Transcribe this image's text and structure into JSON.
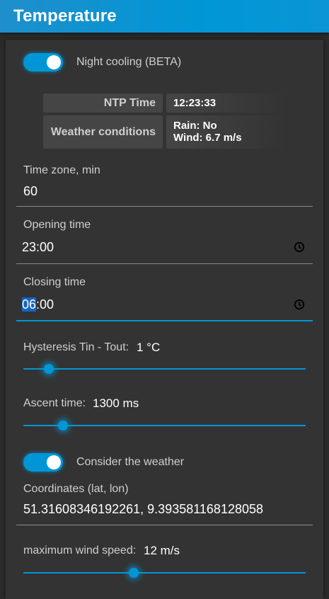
{
  "header": {
    "title": "Temperature"
  },
  "night_cooling": {
    "label": "Night cooling (BETA)",
    "enabled": true
  },
  "info": {
    "ntp_label": "NTP Time",
    "ntp_value": "12:23:33",
    "weather_label": "Weather conditions",
    "weather_rain": "Rain: No",
    "weather_wind": "Wind: 6.7 m/s"
  },
  "timezone": {
    "label": "Time zone, min",
    "value": "60"
  },
  "opening": {
    "label": "Opening time",
    "value": "23:00"
  },
  "closing": {
    "label": "Closing time",
    "hours": "06",
    "rest": ":00"
  },
  "hysteresis": {
    "label": "Hysteresis Tin - Tout:",
    "value": "1 °C",
    "level": 0.09
  },
  "ascent": {
    "label": "Ascent time:",
    "value": "1300 ms",
    "level": 0.14
  },
  "consider_weather": {
    "label": "Consider the weather",
    "enabled": true
  },
  "coordinates": {
    "label": "Coordinates (lat, lon)",
    "value": "51.31608346192261, 9.393581168128058"
  },
  "wind": {
    "label": "maximum wind speed:",
    "value": "12 m/s",
    "level": 0.39
  },
  "colors": {
    "accent": "#0096d6",
    "background": "#2b2b2b",
    "card": "#333333"
  }
}
